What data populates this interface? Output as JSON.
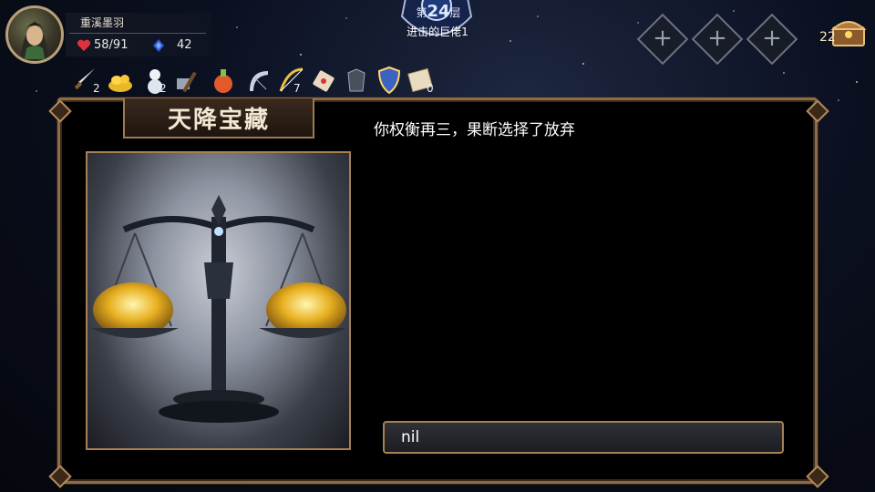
{
  "player": {
    "name": "重溪墨羽",
    "hp": "58/91",
    "mana": "42"
  },
  "floor": {
    "prefix": "第",
    "number": "24",
    "suffix": "层",
    "name": "进击的巨佬1"
  },
  "chest": {
    "count": "22"
  },
  "inventory": [
    {
      "icon": "dagger-icon",
      "count": "2"
    },
    {
      "icon": "gold-pile-icon",
      "count": ""
    },
    {
      "icon": "snowman-icon",
      "count": "2"
    },
    {
      "icon": "hammer-icon",
      "count": ""
    },
    {
      "icon": "potion-icon",
      "count": ""
    },
    {
      "icon": "harp-icon",
      "count": ""
    },
    {
      "icon": "bow-icon",
      "count": "7"
    },
    {
      "icon": "scroll-icon",
      "count": ""
    },
    {
      "icon": "armor-icon",
      "count": ""
    },
    {
      "icon": "shield-icon",
      "count": ""
    },
    {
      "icon": "map-icon",
      "count": "0"
    }
  ],
  "event": {
    "title": "天降宝藏",
    "description": "你权衡再三，果断选择了放弃",
    "choice": "nil"
  }
}
